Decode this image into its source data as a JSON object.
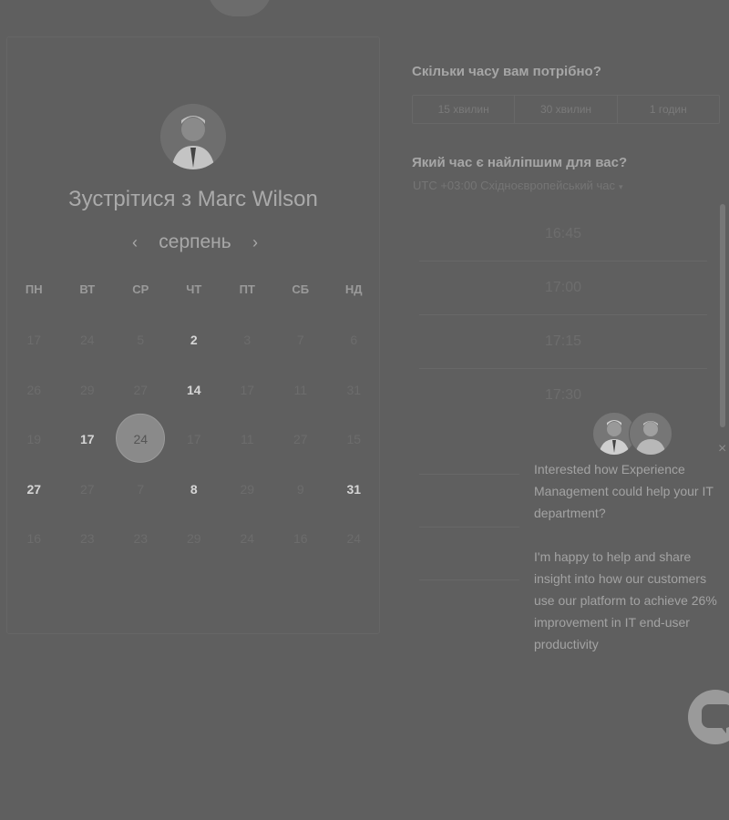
{
  "meeting": {
    "title": "Зустрітися з Marc Wilson",
    "month": "серпень",
    "prev_icon": "‹",
    "next_icon": "›"
  },
  "calendar": {
    "weekdays": [
      "ПН",
      "ВТ",
      "СР",
      "ЧТ",
      "ПТ",
      "СБ",
      "НД"
    ],
    "weeks": [
      [
        {
          "d": "17",
          "active": false
        },
        {
          "d": "24",
          "active": false
        },
        {
          "d": "5",
          "active": false
        },
        {
          "d": "2",
          "active": true
        },
        {
          "d": "3",
          "active": false
        },
        {
          "d": "7",
          "active": false
        },
        {
          "d": "6",
          "active": false
        }
      ],
      [
        {
          "d": "26",
          "active": false
        },
        {
          "d": "29",
          "active": false
        },
        {
          "d": "27",
          "active": false
        },
        {
          "d": "14",
          "active": true
        },
        {
          "d": "17",
          "active": false
        },
        {
          "d": "11",
          "active": false
        },
        {
          "d": "31",
          "active": false
        }
      ],
      [
        {
          "d": "19",
          "active": false
        },
        {
          "d": "17",
          "active": true
        },
        {
          "d": "24",
          "active": false,
          "selected": true
        },
        {
          "d": "17",
          "active": false
        },
        {
          "d": "11",
          "active": false
        },
        {
          "d": "27",
          "active": false
        },
        {
          "d": "15",
          "active": false
        }
      ],
      [
        {
          "d": "27",
          "active": true
        },
        {
          "d": "27",
          "active": false
        },
        {
          "d": "7",
          "active": false
        },
        {
          "d": "8",
          "active": true
        },
        {
          "d": "29",
          "active": false
        },
        {
          "d": "9",
          "active": false
        },
        {
          "d": "31",
          "active": true
        }
      ],
      [
        {
          "d": "16",
          "active": false
        },
        {
          "d": "23",
          "active": false
        },
        {
          "d": "23",
          "active": false
        },
        {
          "d": "29",
          "active": false
        },
        {
          "d": "24",
          "active": false
        },
        {
          "d": "16",
          "active": false
        },
        {
          "d": "24",
          "active": false
        }
      ]
    ]
  },
  "duration": {
    "question": "Скільки часу вам потрібно?",
    "options": [
      "15 хвилин",
      "30 хвилин",
      "1 годин"
    ]
  },
  "time_select": {
    "question": "Який час є найліпшим для вас?",
    "timezone": "UTC +03:00 Східноєвропейський час",
    "caret": "▾",
    "slots": [
      "16:45",
      "17:00",
      "17:15",
      "17:30"
    ]
  },
  "chat": {
    "message1": "Interested how Experience Management could help your IT department?",
    "message2": "I'm happy to help and share insight into how our customers use our platform to achieve 26% improvement in IT end-user productivity",
    "close_icon": "×"
  }
}
